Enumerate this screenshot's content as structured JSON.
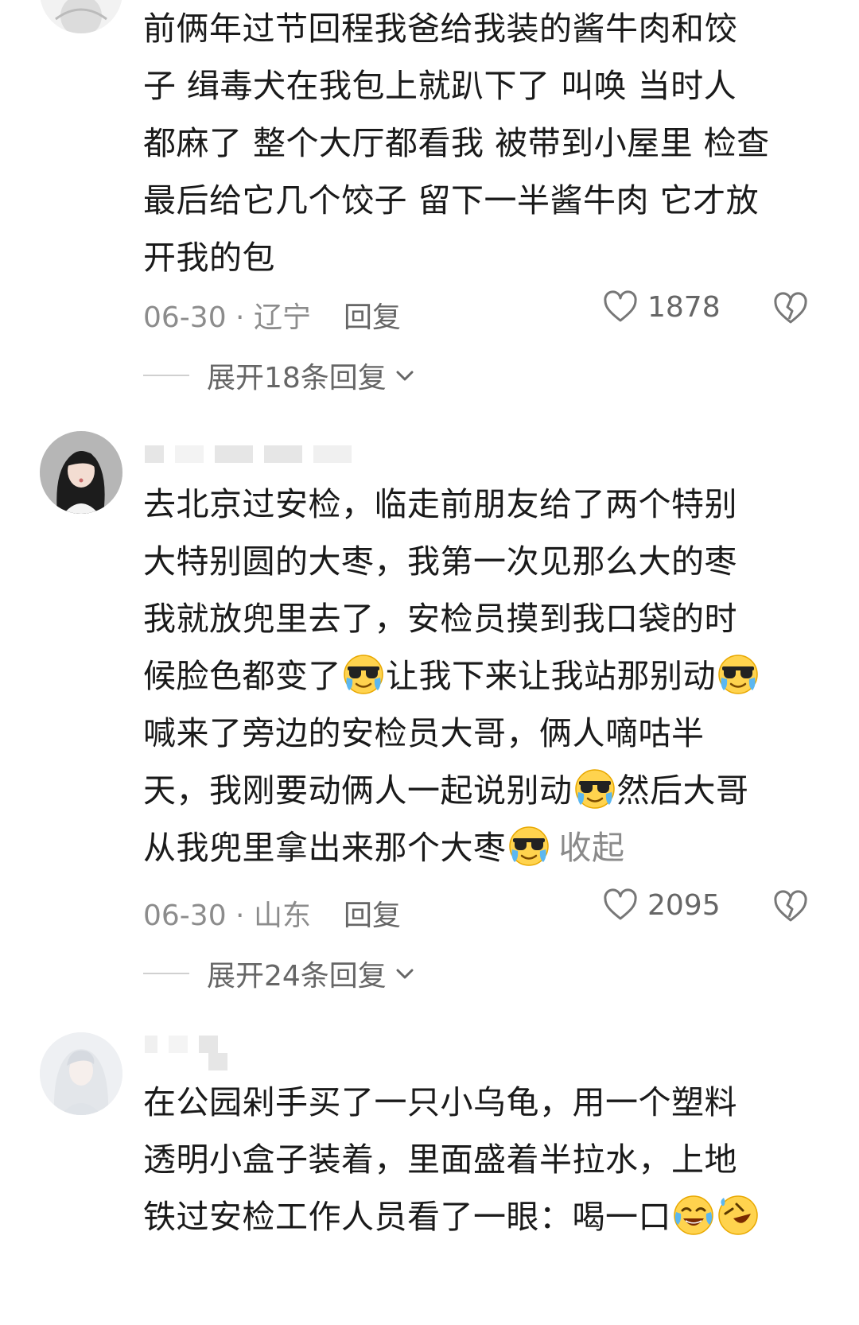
{
  "comments": [
    {
      "lines": [
        "前俩年过节回程我爸给我装的酱牛肉和饺",
        "子 缉毒犬在我包上就趴下了 叫唤  当时人",
        "都麻了 整个大厅都看我 被带到小屋里 检查",
        "最后给它几个饺子 留下一半酱牛肉 它才放",
        "开我的包"
      ],
      "date_location": "06-30 · 辽宁",
      "reply_label": "回复",
      "likes": "1878",
      "expand_label": "展开18条回复"
    },
    {
      "lines": [
        "去北京过安检，临走前朋友给了两个特别",
        "大特别圆的大枣，我第一次见那么大的枣",
        "我就放兜里去了，安检员摸到我口袋的时"
      ],
      "line4_a": "候脸色都变了",
      "line4_b": "让我下来让我站那别动",
      "line5": "喊来了旁边的安检员大哥，俩人嘀咕半",
      "line6_a": "天，我刚要动俩人一起说别动",
      "line6_b": "然后大哥",
      "line7_a": "从我兜里拿出来那个大枣",
      "collapse_label": "收起",
      "emoji_name": "cool-crying-emoji",
      "date_location": "06-30 · 山东",
      "reply_label": "回复",
      "likes": "2095",
      "expand_label": "展开24条回复"
    },
    {
      "lines": [
        "在公园剁手买了一只小乌龟，用一个塑料",
        "透明小盒子装着，里面盛着半拉水，上地"
      ],
      "line3_a": "铁过安检工作人员看了一眼：喝一口"
    }
  ]
}
